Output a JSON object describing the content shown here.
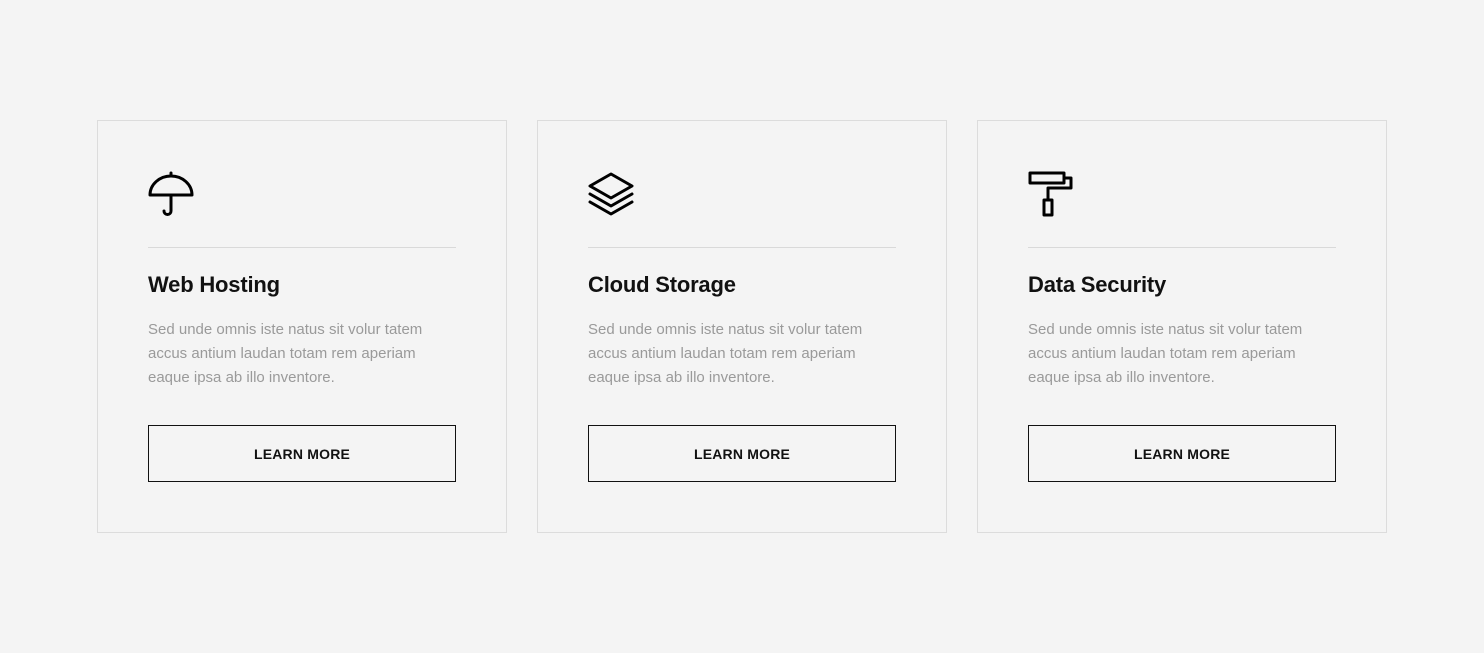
{
  "cards": [
    {
      "icon": "umbrella-icon",
      "title": "Web Hosting",
      "description": "Sed unde omnis iste natus sit volur tatem accus antium laudan totam rem aperiam eaque ipsa ab illo inventore.",
      "button_label": "LEARN MORE"
    },
    {
      "icon": "layers-icon",
      "title": "Cloud Storage",
      "description": "Sed unde omnis iste natus sit volur tatem accus antium laudan totam rem aperiam eaque ipsa ab illo inventore.",
      "button_label": "LEARN MORE"
    },
    {
      "icon": "paint-roller-icon",
      "title": "Data Security",
      "description": "Sed unde omnis iste natus sit volur tatem accus antium laudan totam rem aperiam eaque ipsa ab illo inventore.",
      "button_label": "LEARN MORE"
    }
  ],
  "colors": {
    "background": "#f4f4f4",
    "card_border": "#dcdcdc",
    "title": "#111111",
    "description": "#9a9a9a",
    "button_border": "#111111"
  }
}
